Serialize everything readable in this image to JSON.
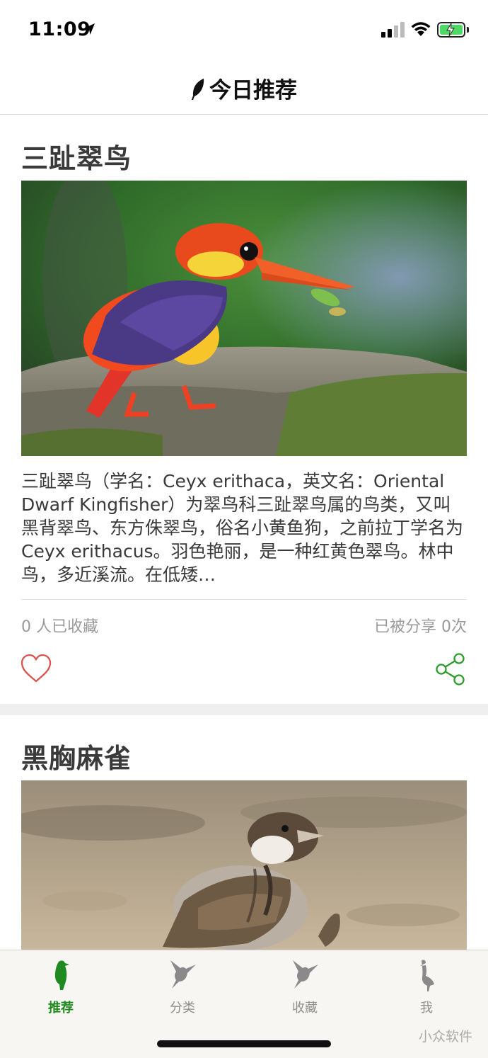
{
  "status_bar": {
    "time": "11:09",
    "icons": [
      "location-arrow-icon",
      "signal-icon",
      "wifi-icon",
      "battery-charging-icon"
    ],
    "battery_color": "#4cd964"
  },
  "nav": {
    "title": "今日推荐",
    "icon": "feather-icon"
  },
  "cards": [
    {
      "title": "三趾翠鸟",
      "image": "kingfisher-photo",
      "description": "三趾翠鸟（学名：Ceyx erithaca，英文名：Oriental Dwarf Kingfisher）为翠鸟科三趾翠鸟属的鸟类，又叫黑背翠鸟、东方侏翠鸟，俗名小黄鱼狗，之前拉丁学名为 Ceyx erithacus。羽色艳丽，是一种红黄色翠鸟。林中鸟，多近溪流。在低矮…",
      "favorites": "0 人已收藏",
      "shares": "已被分享 0次"
    },
    {
      "title": "黑胸麻雀",
      "image": "sparrow-photo"
    }
  ],
  "tabs": [
    {
      "label": "推荐",
      "icon": "bird-standing-icon",
      "active": true
    },
    {
      "label": "分类",
      "icon": "hummingbird-icon",
      "active": false
    },
    {
      "label": "收藏",
      "icon": "hummingbird-icon",
      "active": false
    },
    {
      "label": "我",
      "icon": "heron-icon",
      "active": false
    }
  ],
  "watermark": "小众软件",
  "colors": {
    "accent": "#1f8a1f",
    "heart": "#d9534f",
    "share": "#2e9b2e",
    "muted": "#9a9a9a"
  }
}
